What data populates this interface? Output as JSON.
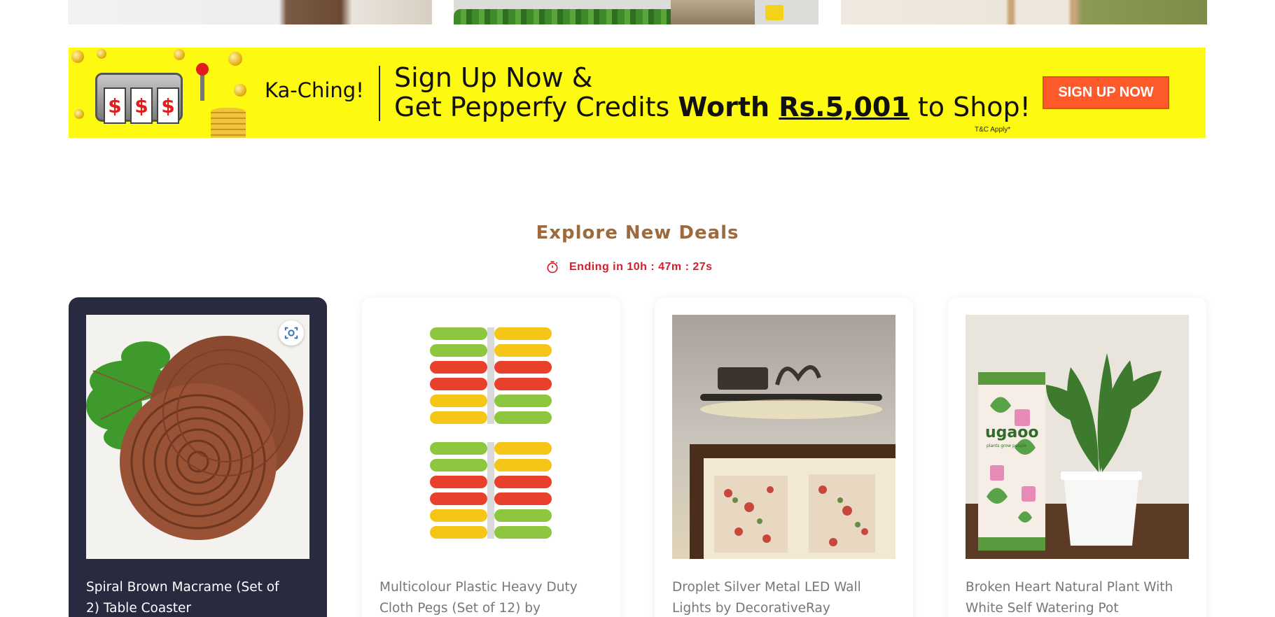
{
  "banner": {
    "kaching": "Ka-Ching!",
    "headline_line1": "Sign Up Now &",
    "headline_line2_a": "Get Pepperfy Credits ",
    "headline_line2_bold": "Worth ",
    "headline_line2_amount": "Rs.5,001",
    "headline_line2_end": " to Shop!",
    "terms": "T&C Apply*",
    "signup_label": "SIGN UP NOW",
    "reel_symbol": "$",
    "background_color": "#fef910",
    "button_color": "#ff5a2a"
  },
  "deals": {
    "title": "Explore New Deals",
    "timer_text": "Ending in 10h : 47m : 27s",
    "title_color": "#9c6a3d",
    "timer_color": "#d31f2b"
  },
  "products": [
    {
      "title": "Spiral Brown Macrame (Set of 2) Table Coaster",
      "image": "macrame-coaster-image"
    },
    {
      "title": "Multicolour Plastic Heavy Duty Cloth Pegs (Set of 12) by",
      "image": "cloth-pegs-image"
    },
    {
      "title": "Droplet Silver Metal LED Wall Lights by DecorativeRay",
      "image": "wall-light-image"
    },
    {
      "title": "Broken Heart Natural Plant With White Self Watering Pot",
      "image": "plant-pot-image"
    }
  ],
  "plant_tube_brand": "ugaoo",
  "plant_tube_tagline": "plants grow people"
}
